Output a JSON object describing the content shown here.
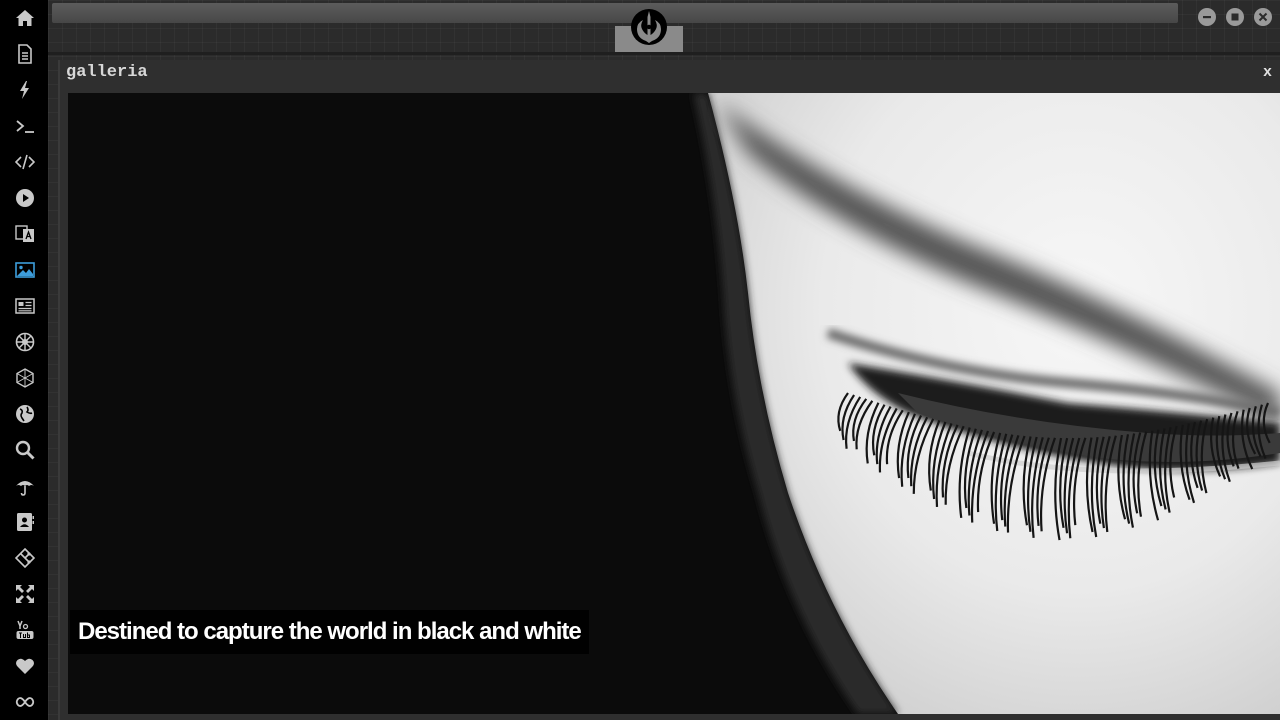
{
  "sidebar": {
    "items": [
      {
        "icon": "home-icon",
        "name": "sidebar-item-home"
      },
      {
        "icon": "document-icon",
        "name": "sidebar-item-documents"
      },
      {
        "icon": "lightning-icon",
        "name": "sidebar-item-power"
      },
      {
        "icon": "terminal-icon",
        "name": "sidebar-item-terminal"
      },
      {
        "icon": "code-icon",
        "name": "sidebar-item-code"
      },
      {
        "icon": "play-icon",
        "name": "sidebar-item-media"
      },
      {
        "icon": "translate-icon",
        "name": "sidebar-item-translate"
      },
      {
        "icon": "image-icon",
        "name": "sidebar-item-gallery",
        "active": true
      },
      {
        "icon": "newspaper-icon",
        "name": "sidebar-item-news"
      },
      {
        "icon": "empire-icon",
        "name": "sidebar-item-empire"
      },
      {
        "icon": "hexagon-icon",
        "name": "sidebar-item-network"
      },
      {
        "icon": "globe-icon",
        "name": "sidebar-item-globe"
      },
      {
        "icon": "search-icon",
        "name": "sidebar-item-search"
      },
      {
        "icon": "umbrella-icon",
        "name": "sidebar-item-weather"
      },
      {
        "icon": "contacts-icon",
        "name": "sidebar-item-contacts"
      },
      {
        "icon": "git-icon",
        "name": "sidebar-item-git"
      },
      {
        "icon": "expand-icon",
        "name": "sidebar-item-fullscreen"
      },
      {
        "icon": "youtube-icon",
        "name": "sidebar-item-youtube"
      },
      {
        "icon": "heart-icon",
        "name": "sidebar-item-favorites"
      },
      {
        "icon": "infinity-icon",
        "name": "sidebar-item-loop"
      }
    ],
    "active_color": "#3d9ddb",
    "icon_color": "#c9c9c9"
  },
  "window": {
    "logo": "rebel-alliance-icon",
    "controls": [
      "minimize-icon",
      "maximize-icon",
      "close-icon"
    ]
  },
  "panel": {
    "title": "galleria",
    "close_label": "x"
  },
  "gallery": {
    "caption": "Destined to capture the world in black and white"
  }
}
